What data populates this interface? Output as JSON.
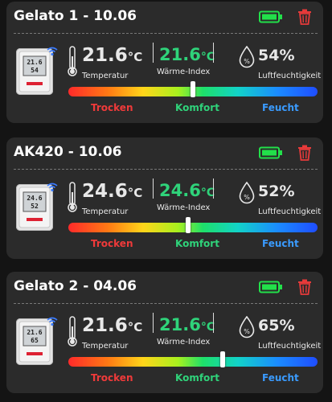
{
  "colors": {
    "battery": "#22e04a",
    "trash": "#e83a3a",
    "heat_index": "#2fd37a",
    "dry": "#f03a3a",
    "comfort": "#2fd37a",
    "humid": "#3a9bff"
  },
  "labels": {
    "temperature": "Temperatur",
    "heat_index": "Wärme-Index",
    "humidity": "Luftfeuchtigkeit",
    "dry": "Trocken",
    "comfort": "Komfort",
    "humid": "Feucht"
  },
  "icons": [
    "battery-full-icon",
    "trash-icon",
    "thermometer-icon",
    "wifi-icon",
    "droplet-percent-icon"
  ],
  "devices": [
    {
      "title": "Gelato 1 - 10.06",
      "temperature": "21.6",
      "heat_index": "21.6",
      "unit": "°C",
      "humidity": "54%",
      "comfort_level": 0.5,
      "display_line1": "21.6",
      "display_line2": "54"
    },
    {
      "title": "AK420 - 10.06",
      "temperature": "24.6",
      "heat_index": "24.6",
      "unit": "°C",
      "humidity": "52%",
      "comfort_level": 0.48,
      "display_line1": "24.6",
      "display_line2": "52"
    },
    {
      "title": "Gelato 2 - 04.06",
      "temperature": "21.6",
      "heat_index": "21.6",
      "unit": "°C",
      "humidity": "65%",
      "comfort_level": 0.62,
      "display_line1": "21.6",
      "display_line2": "65"
    }
  ]
}
